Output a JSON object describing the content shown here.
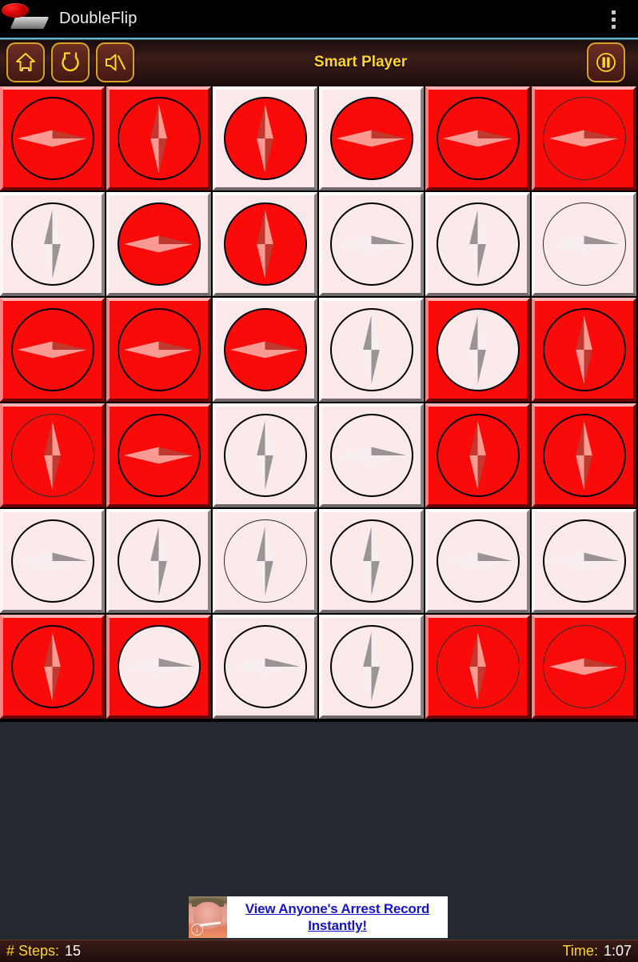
{
  "titlebar": {
    "app_name": "DoubleFlip",
    "logo_icon": "doubleflip-logo-icon",
    "overflow_icon": "overflow-menu-icon"
  },
  "toolbar": {
    "title": "Smart Player",
    "buttons": [
      {
        "name": "home-button",
        "icon": "home-icon"
      },
      {
        "name": "restart-button",
        "icon": "refresh-icon"
      },
      {
        "name": "mute-button",
        "icon": "speaker-muted-icon"
      }
    ],
    "pause_button": {
      "name": "pause-button",
      "icon": "pause-icon"
    }
  },
  "colors": {
    "tile_red": "#fb0a0a",
    "tile_white": "#fbe9e9",
    "accent_yellow": "#ffd42a",
    "toolbar_brown": "#3b1d1a",
    "board_background": "#000000",
    "page_background": "#242930",
    "ad_link_blue": "#1414c8"
  },
  "board": {
    "rows": 6,
    "cols": 6,
    "tiles": [
      {
        "tile": "red",
        "disc": "red",
        "needle": "horizontal",
        "faint": false
      },
      {
        "tile": "red",
        "disc": "red",
        "needle": "vertical",
        "faint": false
      },
      {
        "tile": "white",
        "disc": "red",
        "needle": "vertical",
        "faint": false
      },
      {
        "tile": "white",
        "disc": "red",
        "needle": "horizontal",
        "faint": false
      },
      {
        "tile": "red",
        "disc": "red",
        "needle": "horizontal",
        "faint": false
      },
      {
        "tile": "red",
        "disc": "red",
        "needle": "horizontal",
        "faint": true
      },
      {
        "tile": "white",
        "disc": "white",
        "needle": "vertical",
        "faint": false
      },
      {
        "tile": "white",
        "disc": "red",
        "needle": "horizontal",
        "faint": false
      },
      {
        "tile": "white",
        "disc": "red",
        "needle": "vertical",
        "faint": false
      },
      {
        "tile": "white",
        "disc": "white",
        "needle": "horizontal",
        "faint": false
      },
      {
        "tile": "white",
        "disc": "white",
        "needle": "vertical",
        "faint": false
      },
      {
        "tile": "white",
        "disc": "white",
        "needle": "horizontal",
        "faint": true
      },
      {
        "tile": "red",
        "disc": "red",
        "needle": "horizontal",
        "faint": false
      },
      {
        "tile": "red",
        "disc": "red",
        "needle": "horizontal",
        "faint": false
      },
      {
        "tile": "white",
        "disc": "red",
        "needle": "horizontal",
        "faint": false
      },
      {
        "tile": "white",
        "disc": "white",
        "needle": "vertical",
        "faint": false
      },
      {
        "tile": "red",
        "disc": "white",
        "needle": "vertical",
        "faint": false
      },
      {
        "tile": "red",
        "disc": "red",
        "needle": "vertical",
        "faint": false
      },
      {
        "tile": "red",
        "disc": "red",
        "needle": "vertical",
        "faint": true
      },
      {
        "tile": "red",
        "disc": "red",
        "needle": "horizontal",
        "faint": false
      },
      {
        "tile": "white",
        "disc": "white",
        "needle": "vertical",
        "faint": false
      },
      {
        "tile": "white",
        "disc": "white",
        "needle": "horizontal",
        "faint": false
      },
      {
        "tile": "red",
        "disc": "red",
        "needle": "vertical",
        "faint": false
      },
      {
        "tile": "red",
        "disc": "red",
        "needle": "vertical",
        "faint": false
      },
      {
        "tile": "white",
        "disc": "white",
        "needle": "horizontal",
        "faint": false
      },
      {
        "tile": "white",
        "disc": "white",
        "needle": "vertical",
        "faint": false
      },
      {
        "tile": "white",
        "disc": "white",
        "needle": "vertical",
        "faint": true
      },
      {
        "tile": "white",
        "disc": "white",
        "needle": "vertical",
        "faint": false
      },
      {
        "tile": "white",
        "disc": "white",
        "needle": "horizontal",
        "faint": false
      },
      {
        "tile": "white",
        "disc": "white",
        "needle": "horizontal",
        "faint": false
      },
      {
        "tile": "red",
        "disc": "red",
        "needle": "vertical",
        "faint": false
      },
      {
        "tile": "red",
        "disc": "white",
        "needle": "horizontal",
        "faint": false
      },
      {
        "tile": "white",
        "disc": "white",
        "needle": "horizontal",
        "faint": false
      },
      {
        "tile": "white",
        "disc": "white",
        "needle": "vertical",
        "faint": false
      },
      {
        "tile": "red",
        "disc": "red",
        "needle": "vertical",
        "faint": true
      },
      {
        "tile": "red",
        "disc": "red",
        "needle": "horizontal",
        "faint": true
      }
    ]
  },
  "ad": {
    "line1": "View Anyone's Arrest Record",
    "line2": "Instantly!",
    "thumb_badge": "i",
    "thumb_name": "ad-thumbnail-image"
  },
  "statusbar": {
    "steps_label": "# Steps:",
    "steps_value": "15",
    "time_label": "Time:",
    "time_value": "1:07"
  }
}
